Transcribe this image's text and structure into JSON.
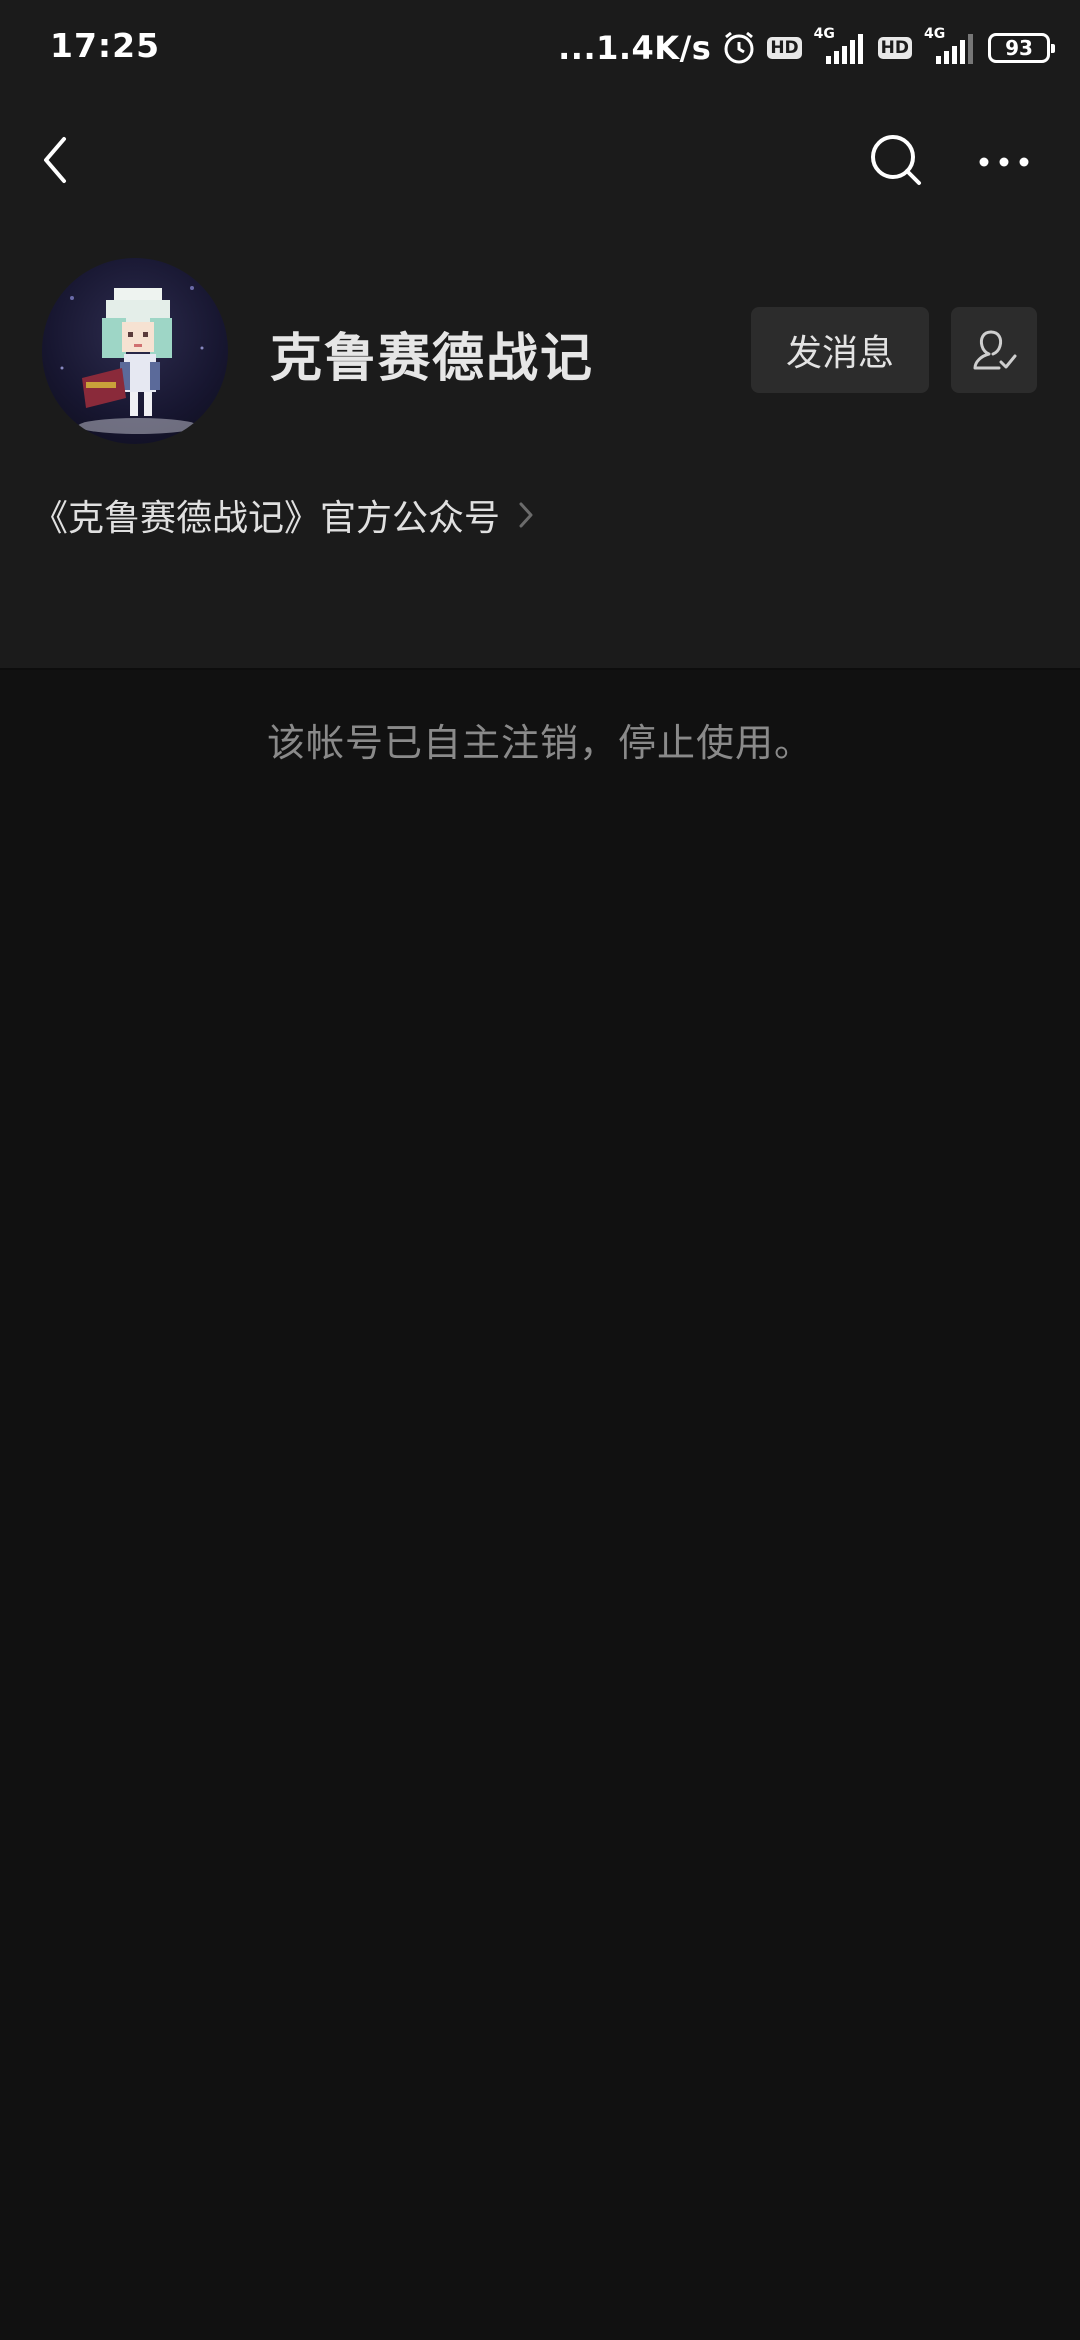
{
  "status_bar": {
    "time": "17:25",
    "net_speed": "...1.4K/s",
    "hd_badge_1": "HD",
    "net_type_1": "4G",
    "hd_badge_2": "HD",
    "net_type_2": "4G",
    "battery": "93",
    "icons": [
      "alarm-icon",
      "signal-icon",
      "battery-icon"
    ]
  },
  "nav": {
    "icons": [
      "back-icon",
      "search-icon",
      "more-icon"
    ]
  },
  "profile": {
    "name": "克鲁赛德战记",
    "send_message_label": "发消息",
    "intro": "《克鲁赛德战记》官方公众号"
  },
  "notice": "该帐号已自主注销，停止使用。",
  "colors": {
    "header_bg": "#1b1b1b",
    "page_bg": "#111111",
    "button_bg": "#2c2c2c",
    "notice_text": "#8a8a8a"
  }
}
